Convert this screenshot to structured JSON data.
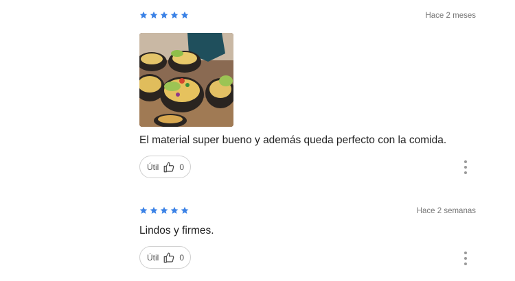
{
  "colors": {
    "star": "#3b82e6",
    "text": "#222222",
    "muted": "#777777",
    "border": "#cfcfcf"
  },
  "reviews": [
    {
      "rating": 5,
      "date": "Hace 2 meses",
      "has_photo": true,
      "photo_icon": "food-photo",
      "text": "El material super bueno y además queda perfecto con la comida.",
      "useful_label": "Útil",
      "useful_count": "0",
      "more_icon": "more-vertical-icon"
    },
    {
      "rating": 5,
      "date": "Hace 2 semanas",
      "has_photo": false,
      "text": "Lindos y firmes.",
      "useful_label": "Útil",
      "useful_count": "0",
      "more_icon": "more-vertical-icon"
    }
  ]
}
